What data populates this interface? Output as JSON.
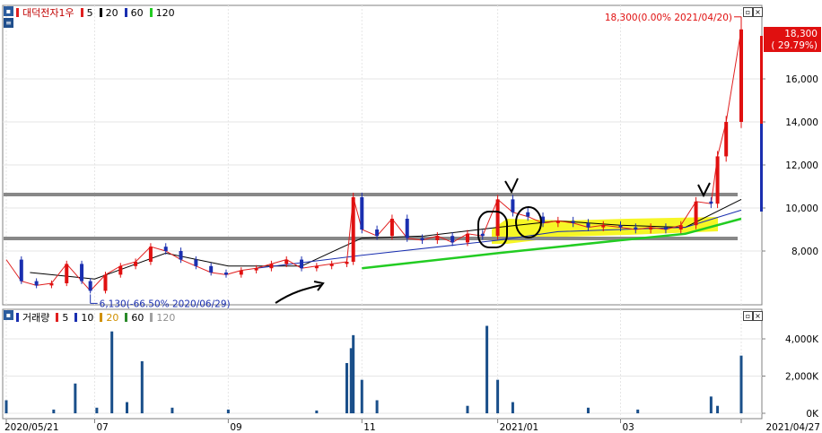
{
  "price_panel": {
    "legend_stock": "대덕전자1우",
    "legend_ma": [
      {
        "label": "5",
        "color": "#e02020"
      },
      {
        "label": "20",
        "color": "#000000"
      },
      {
        "label": "60",
        "color": "#1a2fb0"
      },
      {
        "label": "120",
        "color": "#22cc22"
      }
    ],
    "high_annotation": "18,300(0.00% 2021/04/20)",
    "low_annotation": "6,130(-66.50% 2020/06/29)",
    "current_price_tag": "18,300",
    "current_change_tag": "( 29.79%)"
  },
  "volume_panel": {
    "legend_title": "거래량",
    "legend_ma": [
      {
        "label": "5",
        "color": "#e02020"
      },
      {
        "label": "10",
        "color": "#1a2fb0"
      },
      {
        "label": "20",
        "color": "#d09000"
      },
      {
        "label": "60",
        "color": "#2a8a2a"
      },
      {
        "label": "120",
        "color": "#a0a0a0"
      }
    ]
  },
  "chart_data": [
    {
      "type": "candlestick",
      "title": "대덕전자1우",
      "y_ticks": [
        "16,000",
        "14,000",
        "12,000",
        "10,000",
        "8,000"
      ],
      "y_tick_values": [
        16000,
        14000,
        12000,
        10000,
        8000
      ],
      "ylim": [
        5600,
        19000
      ],
      "x_ticks": [
        "2020/05/21",
        "07",
        "09",
        "11",
        "2021/01",
        "03",
        "2021/04/27"
      ],
      "x_tick_dates": [
        "2020-05-21",
        "2020-07-01",
        "2020-09-01",
        "2020-11-02",
        "2021-01-04",
        "2021-03-02",
        "2021-04-27"
      ],
      "series_close": [
        [
          "2020-05-21",
          7600
        ],
        [
          "2020-05-28",
          6600
        ],
        [
          "2020-06-04",
          6400
        ],
        [
          "2020-06-11",
          6500
        ],
        [
          "2020-06-18",
          7400
        ],
        [
          "2020-06-25",
          6600
        ],
        [
          "2020-06-29",
          6150
        ],
        [
          "2020-07-06",
          6900
        ],
        [
          "2020-07-13",
          7300
        ],
        [
          "2020-07-20",
          7500
        ],
        [
          "2020-07-27",
          8200
        ],
        [
          "2020-08-03",
          8000
        ],
        [
          "2020-08-10",
          7600
        ],
        [
          "2020-08-17",
          7300
        ],
        [
          "2020-08-24",
          7000
        ],
        [
          "2020-08-31",
          6900
        ],
        [
          "2020-09-07",
          7100
        ],
        [
          "2020-09-14",
          7200
        ],
        [
          "2020-09-21",
          7400
        ],
        [
          "2020-09-28",
          7600
        ],
        [
          "2020-10-05",
          7200
        ],
        [
          "2020-10-12",
          7300
        ],
        [
          "2020-10-19",
          7400
        ],
        [
          "2020-10-26",
          7500
        ],
        [
          "2020-10-29",
          10500
        ],
        [
          "2020-11-02",
          9000
        ],
        [
          "2020-11-09",
          8700
        ],
        [
          "2020-11-16",
          9500
        ],
        [
          "2020-11-23",
          8600
        ],
        [
          "2020-11-30",
          8500
        ],
        [
          "2020-12-07",
          8700
        ],
        [
          "2020-12-14",
          8400
        ],
        [
          "2020-12-21",
          8800
        ],
        [
          "2020-12-28",
          8700
        ],
        [
          "2021-01-04",
          10400
        ],
        [
          "2021-01-11",
          9800
        ],
        [
          "2021-01-18",
          9600
        ],
        [
          "2021-01-25",
          9300
        ],
        [
          "2021-02-01",
          9400
        ],
        [
          "2021-02-08",
          9300
        ],
        [
          "2021-02-15",
          9100
        ],
        [
          "2021-02-22",
          9200
        ],
        [
          "2021-03-02",
          9100
        ],
        [
          "2021-03-09",
          9000
        ],
        [
          "2021-03-16",
          9100
        ],
        [
          "2021-03-23",
          9000
        ],
        [
          "2021-03-30",
          9200
        ],
        [
          "2021-04-06",
          10300
        ],
        [
          "2021-04-13",
          10200
        ],
        [
          "2021-04-16",
          12400
        ],
        [
          "2021-04-20",
          14000
        ],
        [
          "2021-04-27",
          18300
        ]
      ],
      "ma_lines": {
        "20": [
          [
            "2020-06-01",
            7000
          ],
          [
            "2020-07-01",
            6700
          ],
          [
            "2020-08-03",
            7900
          ],
          [
            "2020-09-01",
            7300
          ],
          [
            "2020-10-05",
            7300
          ],
          [
            "2020-11-02",
            8600
          ],
          [
            "2020-12-01",
            8700
          ],
          [
            "2021-01-04",
            9100
          ],
          [
            "2021-02-01",
            9400
          ],
          [
            "2021-03-02",
            9200
          ],
          [
            "2021-04-01",
            9100
          ],
          [
            "2021-04-27",
            10400
          ]
        ],
        "60": [
          [
            "2020-09-14",
            7200
          ],
          [
            "2020-11-02",
            7800
          ],
          [
            "2021-01-04",
            8500
          ],
          [
            "2021-02-01",
            8900
          ],
          [
            "2021-03-02",
            9000
          ],
          [
            "2021-04-01",
            9100
          ],
          [
            "2021-04-27",
            9900
          ]
        ],
        "120": [
          [
            "2020-11-02",
            7200
          ],
          [
            "2021-01-04",
            7900
          ],
          [
            "2021-03-02",
            8500
          ],
          [
            "2021-04-01",
            8800
          ],
          [
            "2021-04-27",
            9500
          ]
        ]
      }
    },
    {
      "type": "bar",
      "title": "거래량",
      "y_ticks": [
        "4,000K",
        "2,000K",
        "0K"
      ],
      "y_tick_values": [
        4000,
        2000,
        0
      ],
      "ylim": [
        0,
        5200
      ],
      "ylabel_unit": "K",
      "values": [
        [
          "2020-05-21",
          700
        ],
        [
          "2020-06-12",
          200
        ],
        [
          "2020-06-22",
          1600
        ],
        [
          "2020-07-02",
          300
        ],
        [
          "2020-07-09",
          4400
        ],
        [
          "2020-07-16",
          600
        ],
        [
          "2020-07-23",
          2800
        ],
        [
          "2020-08-06",
          300
        ],
        [
          "2020-09-01",
          200
        ],
        [
          "2020-10-12",
          150
        ],
        [
          "2020-10-26",
          2700
        ],
        [
          "2020-10-28",
          3500
        ],
        [
          "2020-10-29",
          4200
        ],
        [
          "2020-11-02",
          1800
        ],
        [
          "2020-11-09",
          700
        ],
        [
          "2020-12-21",
          400
        ],
        [
          "2020-12-30",
          4700
        ],
        [
          "2021-01-04",
          1800
        ],
        [
          "2021-01-11",
          600
        ],
        [
          "2021-02-15",
          300
        ],
        [
          "2021-03-10",
          200
        ],
        [
          "2021-04-13",
          900
        ],
        [
          "2021-04-16",
          400
        ],
        [
          "2021-04-27",
          3100
        ]
      ]
    }
  ]
}
